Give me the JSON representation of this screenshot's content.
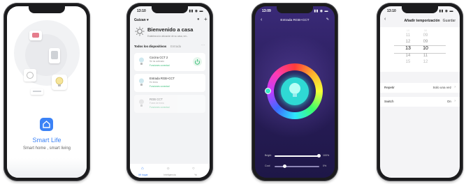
{
  "phone1": {
    "app_name": "Smart Life",
    "tagline": "Smart home , smart living",
    "accent": "#3b82f6"
  },
  "phone2": {
    "time": "13:10",
    "user": "Guizan",
    "welcome": "Bienvenido a casa",
    "location_hint": "Establezca la ubicación de su casa, ver...",
    "tabs": [
      "Todos los dispositivos",
      "Entrada"
    ],
    "devices": [
      {
        "name": "Cocina CCT 2",
        "sub": "Se ha activado",
        "fn": "Funciones conectad"
      },
      {
        "name": "Entrada RGB+CCT",
        "sub": "En línea",
        "fn": "Funciones conectad"
      },
      {
        "name": "RGB CCT",
        "sub": "Fuera de línea",
        "fn": "Funciones conectad"
      }
    ],
    "bottom_tabs": [
      "Mi hogar",
      "Inteligencia",
      "Yo"
    ]
  },
  "phone3": {
    "time": "13:09",
    "title": "Entrada RGB+CCT",
    "bright_label": "Bright",
    "bright_value": "100%",
    "cool_label": "Cool",
    "cool_value": "0%",
    "bright_level": 1.0,
    "cool_level": 0.0
  },
  "phone4": {
    "time": "13:10",
    "title": "Añadir temporización",
    "save": "Guardar",
    "hours": [
      "11",
      "12",
      "13",
      "14",
      "15"
    ],
    "minutes": [
      "09",
      "09",
      "10",
      "11",
      "12"
    ],
    "hours_top": "10",
    "minutes_top": "08",
    "repeat_label": "Repetir",
    "repeat_value": "Solo una vez",
    "switch_label": "Switch",
    "switch_value": "On"
  }
}
